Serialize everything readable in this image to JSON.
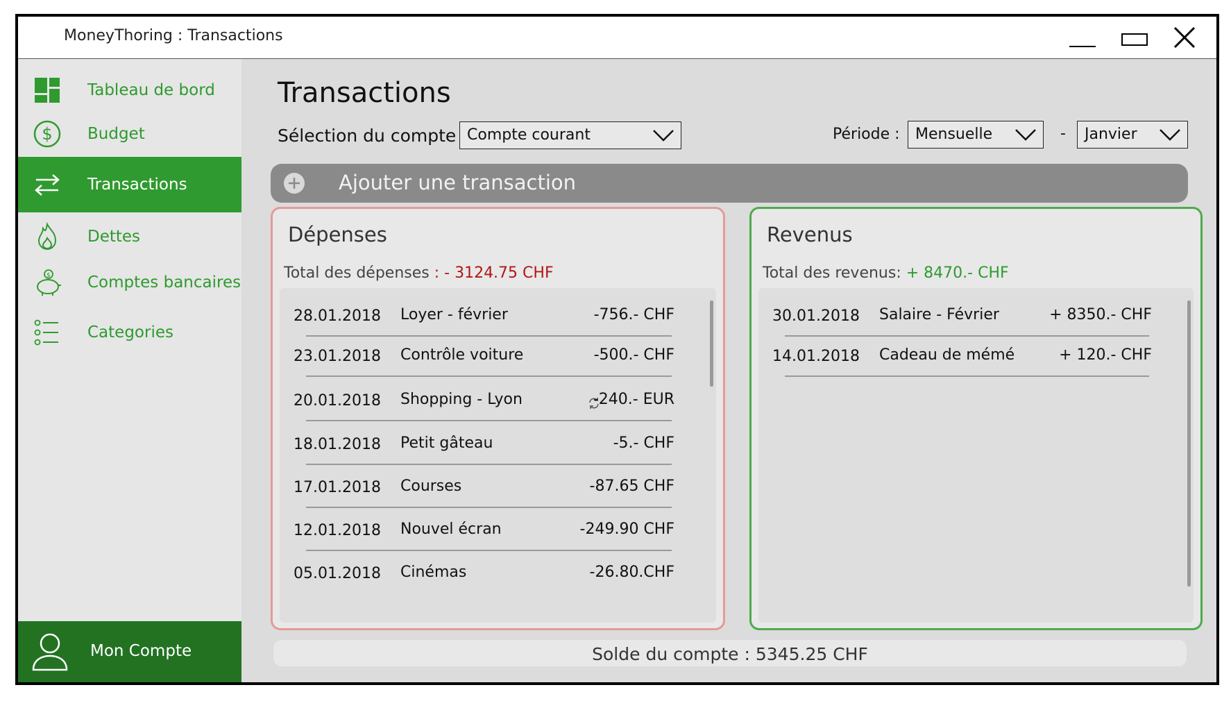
{
  "window": {
    "title": "MoneyThoring : Transactions"
  },
  "sidebar": {
    "items": [
      {
        "label": "Tableau de bord",
        "icon": "dashboard-icon"
      },
      {
        "label": "Budget",
        "icon": "dollar-icon"
      },
      {
        "label": "Transactions",
        "icon": "transfer-arrows-icon",
        "active": true
      },
      {
        "label": "Dettes",
        "icon": "flame-icon"
      },
      {
        "label": "Comptes bancaires",
        "icon": "piggy-bank-icon"
      },
      {
        "label": "Categories",
        "icon": "list-icon"
      }
    ],
    "account_label": "Mon Compte"
  },
  "main": {
    "title": "Transactions",
    "account_select_label": "Sélection du compte :",
    "account_value": "Compte courant",
    "period_label": "Période :",
    "period_value": "Mensuelle",
    "separator": "-",
    "month_value": "Janvier",
    "add_label": "Ajouter une transaction"
  },
  "expenses": {
    "title": "Dépenses",
    "total_label": "Total des dépenses",
    "total_value": ": - 3124.75 CHF",
    "rows": [
      {
        "date": "28.01.2018",
        "desc": "Loyer - février",
        "amount": "-756.- CHF"
      },
      {
        "date": "23.01.2018",
        "desc": "Contrôle voiture",
        "amount": "-500.- CHF"
      },
      {
        "date": "20.01.2018",
        "desc": "Shopping - Lyon",
        "amount": "-240.- EUR",
        "recurring": true
      },
      {
        "date": "18.01.2018",
        "desc": "Petit gâteau",
        "amount": "-5.- CHF"
      },
      {
        "date": "17.01.2018",
        "desc": "Courses",
        "amount": "-87.65 CHF"
      },
      {
        "date": "12.01.2018",
        "desc": "Nouvel écran",
        "amount": "-249.90 CHF"
      },
      {
        "date": "05.01.2018",
        "desc": "Cinémas",
        "amount": "-26.80.CHF"
      }
    ]
  },
  "income": {
    "title": "Revenus",
    "total_label": "Total des revenus:",
    "total_value": "+ 8470.- CHF",
    "rows": [
      {
        "date": "30.01.2018",
        "desc": "Salaire - Février",
        "amount": "+ 8350.- CHF"
      },
      {
        "date": "14.01.2018",
        "desc": "Cadeau de mémé",
        "amount": "+ 120.- CHF"
      }
    ]
  },
  "balance": {
    "label": "Solde du compte : 5345.25 CHF"
  },
  "colors": {
    "accent": "#2f9a2f",
    "dark_accent": "#227222",
    "expense_border": "#e39a9a",
    "income_border": "#4daa4d",
    "negative_total": "#b21616"
  }
}
